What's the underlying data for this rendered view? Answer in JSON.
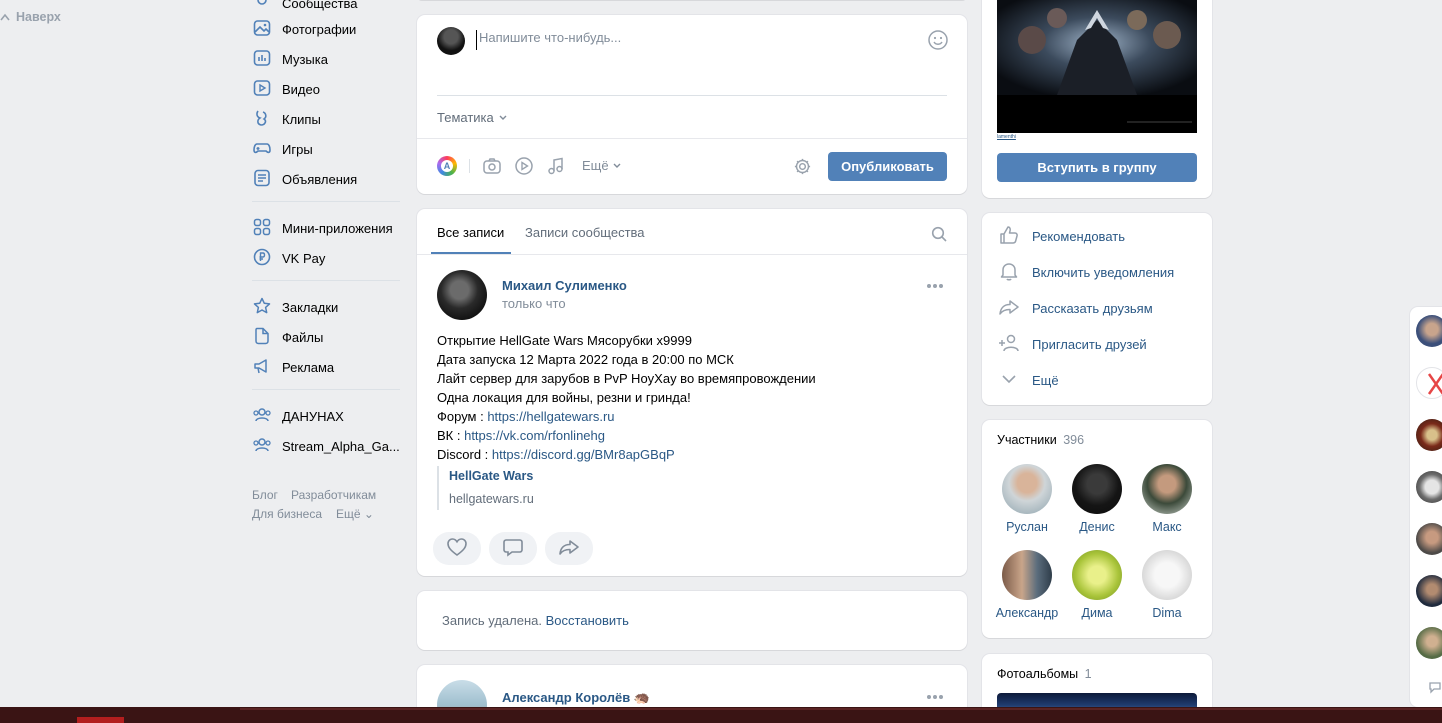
{
  "nav": {
    "back_to_top": "Наверх",
    "communities_partial": "Сообщества",
    "items": [
      {
        "label": "Фотографии",
        "icon": "photo-icon"
      },
      {
        "label": "Музыка",
        "icon": "music-icon"
      },
      {
        "label": "Видео",
        "icon": "video-icon"
      },
      {
        "label": "Клипы",
        "icon": "clips-icon"
      },
      {
        "label": "Игры",
        "icon": "games-icon"
      },
      {
        "label": "Объявления",
        "icon": "classifieds-icon"
      },
      {
        "label": "Мини-приложения",
        "icon": "mini-apps-icon"
      },
      {
        "label": "VK Pay",
        "icon": "vkpay-icon"
      },
      {
        "label": "Закладки",
        "icon": "bookmark-icon"
      },
      {
        "label": "Файлы",
        "icon": "files-icon"
      },
      {
        "label": "Реклама",
        "icon": "ads-icon"
      },
      {
        "label": "ДАНУНАХ",
        "icon": "group-icon"
      },
      {
        "label": "Stream_Alpha_Ga...",
        "icon": "group-icon"
      }
    ],
    "footer": {
      "blog": "Блог",
      "developers": "Разработчикам",
      "business": "Для бизнеса",
      "more": "Ещё"
    }
  },
  "composer": {
    "placeholder": "Напишите что-нибудь...",
    "topic": "Тематика",
    "more": "Ещё",
    "publish": "Опубликовать"
  },
  "wall": {
    "tabs": [
      "Все записи",
      "Записи сообщества"
    ],
    "post": {
      "author": "Михаил Сулименко",
      "time": "только что",
      "lines": [
        "Открытие HellGate Wars Мясорубки x9999",
        "Дата запуска 12 Марта 2022 года в 20:00 по МСК",
        "Лайт сервер для зарубов в PvP HoyXay во времяпровождении",
        "Одна локация для войны, резни и гринда!"
      ],
      "forum_label": "Форум : ",
      "forum_link": "https://hellgatewars.ru",
      "vk_label": "ВК : ",
      "vk_link": "https://vk.com/rfonlinehg",
      "discord_label": "Discord : ",
      "discord_link": "https://discord.gg/BMr8apGBqP",
      "snippet_title": "HellGate Wars",
      "snippet_domain": "hellgatewars.ru"
    },
    "deleted": {
      "text": "Запись удалена.",
      "restore": "Восстановить"
    },
    "next_post": {
      "author": "Александр Королёв",
      "emoji": "🦔"
    }
  },
  "sidebar": {
    "cover_caption": "lamenthi",
    "join": "Вступить в группу",
    "actions": [
      {
        "label": "Рекомендовать",
        "icon": "thumb-up-icon"
      },
      {
        "label": "Включить уведомления",
        "icon": "bell-icon"
      },
      {
        "label": "Рассказать друзьям",
        "icon": "share-icon"
      },
      {
        "label": "Пригласить друзей",
        "icon": "add-user-icon"
      },
      {
        "label": "Ещё",
        "icon": "chevron-down-icon"
      }
    ],
    "members_title": "Участники",
    "members_count": "396",
    "members": [
      "Руслан",
      "Денис",
      "Макс",
      "Александр",
      "Дима",
      "Dima"
    ],
    "albums_title": "Фотоальбомы",
    "albums_count": "1"
  },
  "colors": {
    "accent": "#5181b8",
    "link": "#2a5885",
    "background": "#edeef0",
    "taskbar": "#3a1414"
  }
}
